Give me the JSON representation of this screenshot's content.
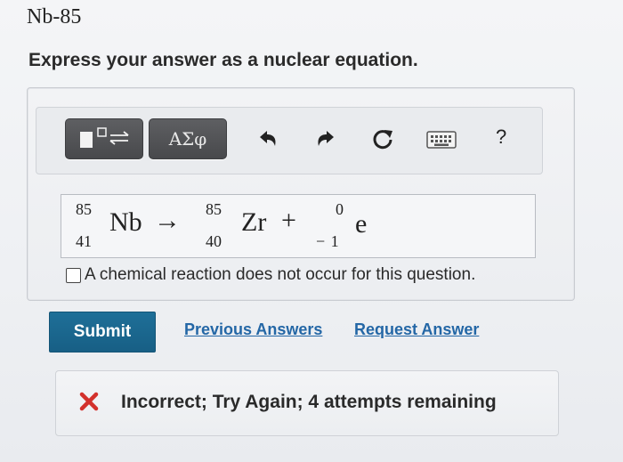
{
  "question": {
    "title": "Nb-85",
    "prompt": "Express your answer as a nuclear equation."
  },
  "toolbar": {
    "template_icon": "template-fraction-icon",
    "symbols_label": "ΑΣφ",
    "undo_icon": "undo-icon",
    "redo_icon": "redo-icon",
    "reset_icon": "reset-icon",
    "keyboard_icon": "keyboard-icon",
    "help_label": "?"
  },
  "equation": {
    "reactant": {
      "mass": "85",
      "atomic": "41",
      "symbol": "Nb"
    },
    "arrow": "→",
    "product1": {
      "mass": "85",
      "atomic": "40",
      "symbol": "Zr"
    },
    "plus": "+",
    "product2": {
      "mass": "0",
      "atomic": "− 1",
      "symbol": "e"
    }
  },
  "no_reaction": {
    "label": "A chemical reaction does not occur for this question.",
    "checked": false
  },
  "actions": {
    "submit_label": "Submit",
    "previous_answers_label": "Previous Answers",
    "request_answer_label": "Request Answer"
  },
  "feedback": {
    "icon": "x-icon",
    "text": "Incorrect; Try Again; 4 attempts remaining",
    "color": "#d3312c"
  },
  "colors": {
    "submit_bg": "#1f6f98",
    "link": "#2467a6",
    "toolbar_dark": "#48494c"
  }
}
